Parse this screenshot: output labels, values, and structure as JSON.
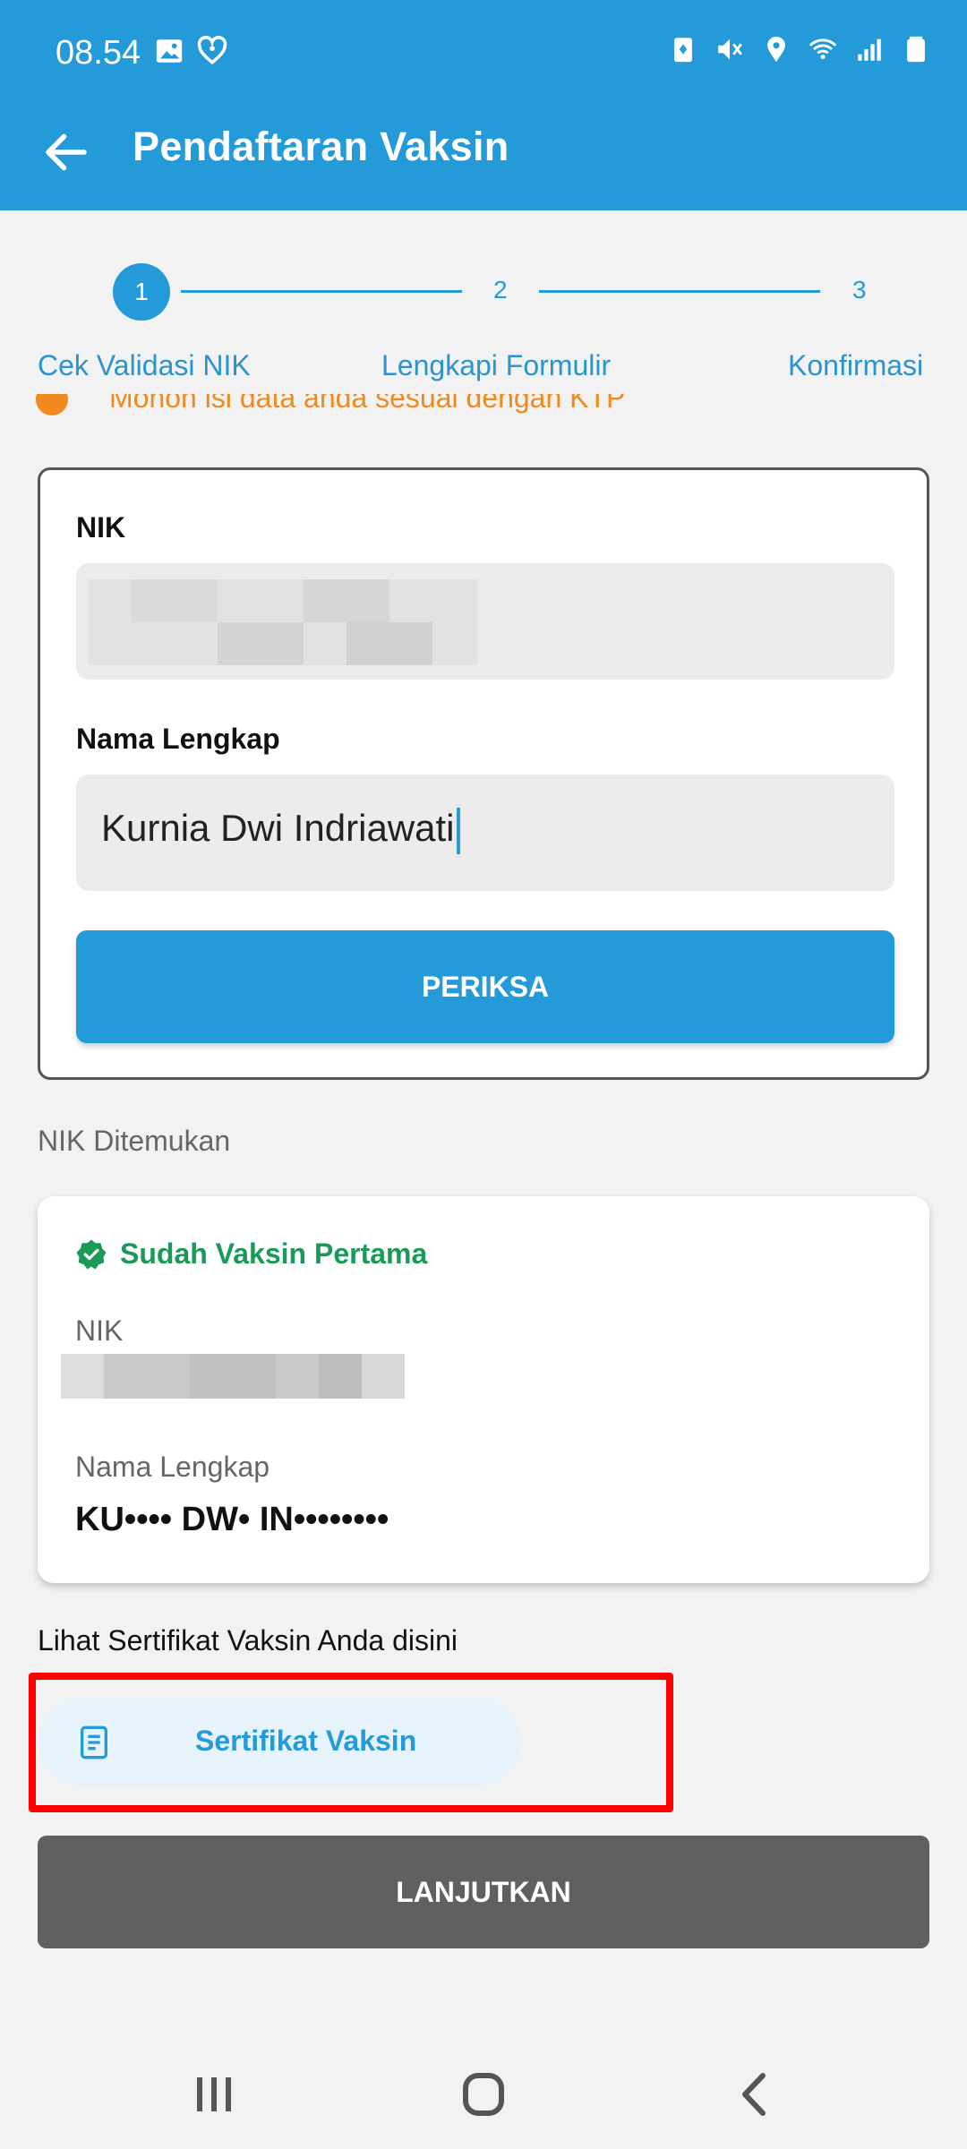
{
  "status_bar": {
    "time": "08.54",
    "icons_left": [
      "gallery-icon",
      "health-icon"
    ],
    "icons_right": [
      "battery-saver-icon",
      "mute-icon",
      "location-icon",
      "wifi-icon",
      "signal-icon",
      "battery-icon"
    ]
  },
  "app_bar": {
    "title": "Pendaftaran Vaksin",
    "back_icon": "arrow-left-icon"
  },
  "stepper": {
    "steps": [
      {
        "number": "1",
        "label": "Cek Validasi NIK",
        "active": true
      },
      {
        "number": "2",
        "label": "Lengkapi Formulir",
        "active": false
      },
      {
        "number": "3",
        "label": "Konfirmasi",
        "active": false
      }
    ]
  },
  "warning": {
    "text": "Mohon isi data anda sesuai dengan KTP"
  },
  "form": {
    "nik_label": "NIK",
    "nik_value": "",
    "name_label": "Nama Lengkap",
    "name_value": "Kurnia Dwi Indriawati",
    "check_button": "PERIKSA"
  },
  "result": {
    "section_label": "NIK Ditemukan",
    "status": "Sudah Vaksin Pertama",
    "nik_label": "NIK",
    "name_label": "Nama Lengkap",
    "name_value": "KU•••• DW• IN••••••••"
  },
  "certificate": {
    "hint": "Lihat Sertifikat Vaksin Anda disini",
    "button_label": "Sertifikat Vaksin"
  },
  "continue_button": "LANJUTKAN",
  "colors": {
    "primary": "#249bd8",
    "success": "#1a9a56",
    "warning": "#f08a1e",
    "highlight": "#ff0000",
    "disabled": "#606060"
  }
}
